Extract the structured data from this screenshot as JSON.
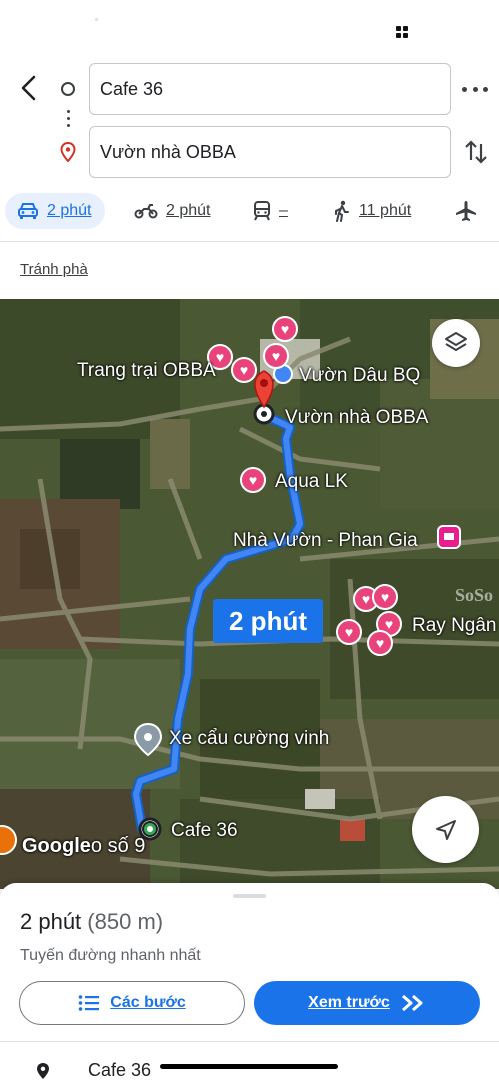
{
  "header": {
    "origin_value": "Cafe 36",
    "destination_value": "Vườn nhà OBBA"
  },
  "modes": [
    {
      "name": "car",
      "label": "2 phút",
      "active": true
    },
    {
      "name": "motorbike",
      "label": "2 phút",
      "active": false
    },
    {
      "name": "transit",
      "label": "–",
      "active": false
    },
    {
      "name": "walk",
      "label": "11 phút",
      "active": false
    },
    {
      "name": "flight",
      "label": "",
      "active": false
    }
  ],
  "avoid_label": "Tránh phà",
  "map": {
    "labels": {
      "trang_trai": "Trang trại OBBA",
      "vuon_dau": "Vườn Dâu BQ",
      "vuon_nha": "Vườn nhà OBBA",
      "aqua": "Aqua LK",
      "nha_vuon": "Nhà Vườn - Phan Gia",
      "ray_ngan": "Ray Ngân",
      "xe_cau": "Xe cẩu cường vinh",
      "cafe": "Cafe 36",
      "watermark": "SoSo"
    },
    "route_time": "2 phút",
    "google_logo": "Google",
    "street_fragment": "o số 9",
    "route_color": "#1a73e8"
  },
  "sheet": {
    "duration": "2 phút",
    "distance": "(850 m)",
    "description": "Tuyến đường nhanh nhất",
    "steps_label": "Các bước",
    "preview_label": "Xem trước",
    "next_place": "Cafe 36"
  }
}
